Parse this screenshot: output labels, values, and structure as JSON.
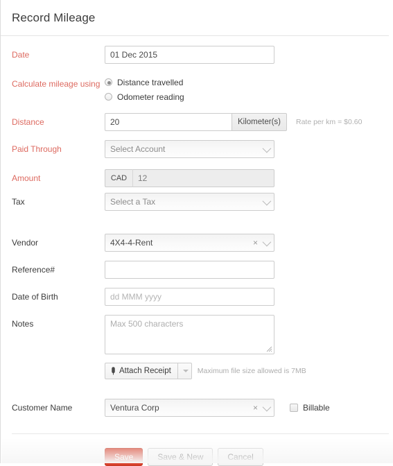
{
  "header": {
    "title": "Record Mileage"
  },
  "colors": {
    "required_label": "#dd6a60",
    "primary_button": "#d8412c",
    "label": "#3b3b3b",
    "placeholder": "#b4b4b4"
  },
  "form": {
    "date": {
      "label": "Date",
      "value": "01 Dec 2015",
      "placeholder": ""
    },
    "calculate_using": {
      "label": "Calculate mileage using",
      "options": [
        {
          "label": "Distance travelled",
          "selected": true
        },
        {
          "label": "Odometer reading",
          "selected": false
        }
      ]
    },
    "distance": {
      "label": "Distance",
      "value": "20",
      "unit_button": "Kilometer(s)",
      "rate_hint": "Rate per km = $0.60"
    },
    "paid_through": {
      "label": "Paid Through",
      "value": "Select Account",
      "is_placeholder": true
    },
    "amount": {
      "label": "Amount",
      "currency": "CAD",
      "value": "12",
      "readonly": true
    },
    "tax": {
      "label": "Tax",
      "value": "Select a Tax",
      "is_placeholder": true
    },
    "vendor": {
      "label": "Vendor",
      "value": "4X4-4-Rent",
      "clear_icon": "×"
    },
    "reference": {
      "label": "Reference#",
      "value": "",
      "placeholder": ""
    },
    "date_of_birth": {
      "label": "Date of Birth",
      "value": "",
      "placeholder": "dd MMM yyyy"
    },
    "notes": {
      "label": "Notes",
      "value": "",
      "placeholder": "Max 500 characters"
    },
    "attachment": {
      "button_label": "Attach Receipt",
      "icon": "paperclip-icon",
      "dropdown_icon": "caret-down-icon",
      "hint": "Maximum file size allowed is 7MB"
    },
    "customer_name": {
      "label": "Customer Name",
      "value": "Ventura Corp",
      "clear_icon": "×"
    },
    "billable": {
      "label": "Billable",
      "checked": false
    }
  },
  "actions": {
    "save": "Save",
    "save_and_new": "Save & New",
    "cancel": "Cancel"
  }
}
